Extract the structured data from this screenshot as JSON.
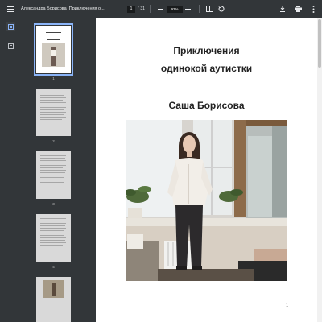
{
  "toolbar": {
    "title": "Александра Борисова_Приключения о...",
    "current_page": "1",
    "separator": "/",
    "total_pages": "31",
    "zoom": "93%"
  },
  "icons": {
    "menu": "menu-icon",
    "zoom_out": "minus-icon",
    "zoom_in": "plus-icon",
    "fit": "fit-page-icon",
    "rotate": "rotate-icon",
    "download": "download-icon",
    "print": "print-icon",
    "more": "more-vert-icon",
    "thumbnails": "thumbnails-icon",
    "outline": "document-outline-icon"
  },
  "sidebar": {
    "thumbnails": [
      {
        "number": "1",
        "selected": true
      },
      {
        "number": "2",
        "selected": false
      },
      {
        "number": "3",
        "selected": false
      },
      {
        "number": "4",
        "selected": false
      },
      {
        "number": "5",
        "selected": false
      }
    ]
  },
  "document": {
    "title_line1": "Приключения",
    "title_line2": "одинокой аутистки",
    "author": "Саша Борисова",
    "page_number": "1"
  },
  "colors": {
    "toolbar_bg": "#323639",
    "viewer_bg": "#525659",
    "selected_outline": "#8ab4f8"
  }
}
